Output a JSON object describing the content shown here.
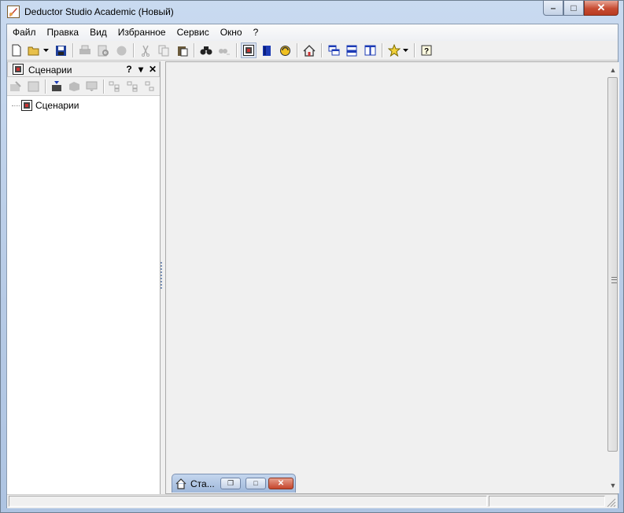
{
  "window": {
    "title": "Deductor Studio Academic (Новый)",
    "controls": {
      "minimize": "–",
      "maximize": "□",
      "close": "✕"
    }
  },
  "menu": {
    "items": [
      "Файл",
      "Правка",
      "Вид",
      "Избранное",
      "Сервис",
      "Окно",
      "?"
    ]
  },
  "toolbar": {
    "icons": [
      "new-file-icon",
      "open-folder-icon",
      "save-icon",
      "print-icon",
      "print-preview-icon",
      "export-icon",
      "cut-icon",
      "copy-icon",
      "paste-icon",
      "find-icon",
      "find-next-icon",
      "scenarios-icon",
      "notebook-icon",
      "refresh-icon",
      "home-icon",
      "cascade-windows-icon",
      "tile-horizontal-icon",
      "tile-vertical-icon",
      "favorites-star-icon",
      "help-icon"
    ]
  },
  "panel": {
    "title": "Сценарии",
    "help_label": "?",
    "menu_label": "▾",
    "close_label": "✕",
    "tree": [
      {
        "label": "Сценарии"
      }
    ]
  },
  "mdi": {
    "minimized_window": {
      "title": "Ста..."
    }
  },
  "colors": {
    "frame": "#b6cae5",
    "client": "#f0f0f0",
    "close_button": "#c74c32"
  }
}
